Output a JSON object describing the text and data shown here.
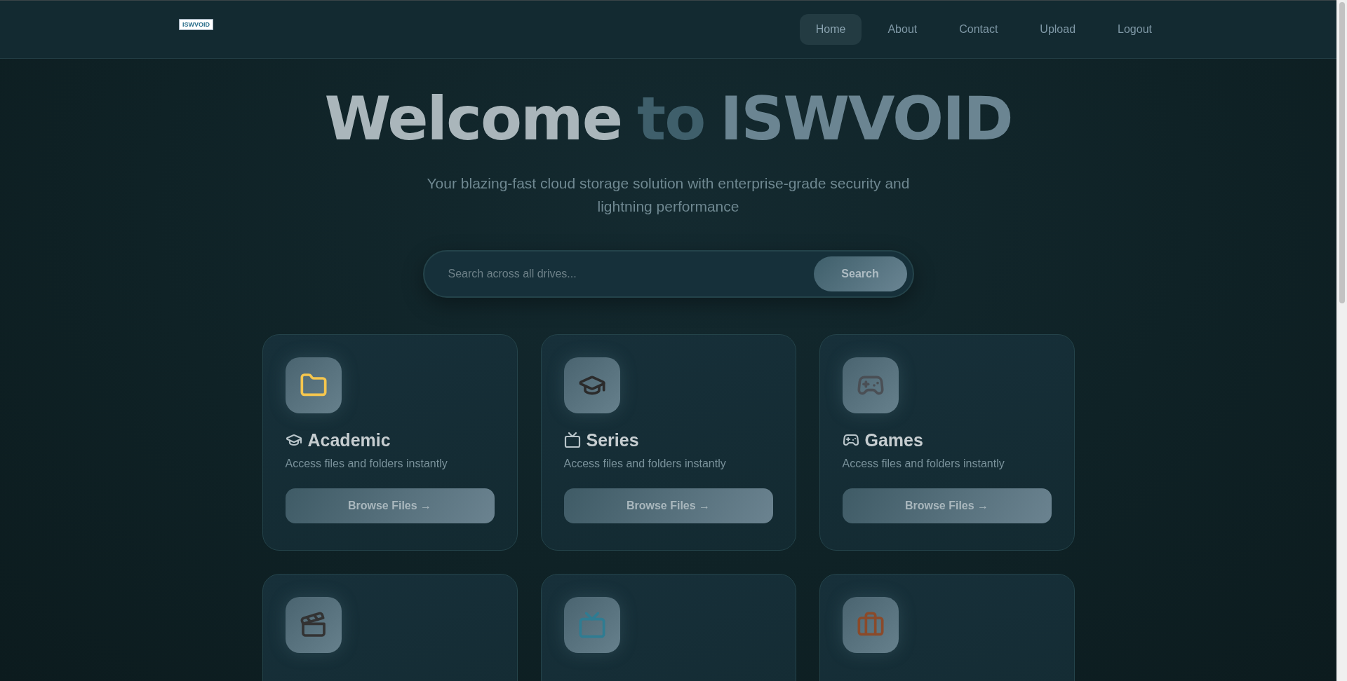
{
  "logo": {
    "text": "ISWVOID"
  },
  "nav": [
    {
      "label": "Home",
      "selected": true
    },
    {
      "label": "About",
      "selected": false
    },
    {
      "label": "Contact",
      "selected": false
    },
    {
      "label": "Upload",
      "selected": false
    },
    {
      "label": "Logout",
      "selected": false
    }
  ],
  "hero": {
    "title_parts": [
      "Welcome",
      "to",
      "ISWVOID"
    ],
    "subtitle": "Your blazing-fast cloud storage solution with enterprise-grade security and lightning performance"
  },
  "search": {
    "placeholder": "Search across all drives...",
    "button": "Search"
  },
  "cards": [
    {
      "kind": "full",
      "title": "Academic",
      "description": "Access files and folders instantly",
      "button": "Browse Files →"
    },
    {
      "kind": "full",
      "title": "Series",
      "description": "Access files and folders instantly",
      "button": "Browse Files →"
    },
    {
      "kind": "full",
      "title": "Games",
      "description": "Access files and folders instantly",
      "button": "Browse Files →"
    },
    {
      "kind": "cut"
    },
    {
      "kind": "cut"
    },
    {
      "kind": "cut"
    }
  ]
}
